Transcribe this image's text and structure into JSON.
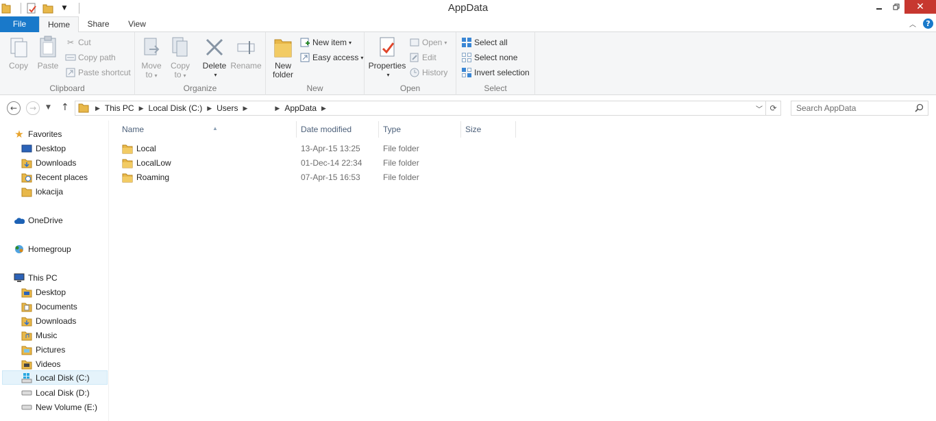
{
  "window": {
    "title": "AppData",
    "minimize_icon": "minimize-icon",
    "maximize_icon": "restore-icon",
    "close_glyph": "✕"
  },
  "quick_access": [
    "folder-icon",
    "properties-icon",
    "new-folder-icon",
    "dropdown-icon"
  ],
  "tabs": {
    "file": "File",
    "home": "Home",
    "share": "Share",
    "view": "View",
    "help_glyph": "?"
  },
  "ribbon": {
    "clipboard": {
      "label": "Clipboard",
      "copy": "Copy",
      "paste": "Paste",
      "cut": "Cut",
      "copy_path": "Copy path",
      "paste_shortcut": "Paste shortcut"
    },
    "organize": {
      "label": "Organize",
      "move_to_1": "Move",
      "move_to_2": "to",
      "copy_to_1": "Copy",
      "copy_to_2": "to",
      "delete": "Delete",
      "rename": "Rename"
    },
    "new": {
      "label": "New",
      "new_folder_1": "New",
      "new_folder_2": "folder",
      "new_item": "New item",
      "easy_access": "Easy access"
    },
    "open": {
      "label": "Open",
      "properties": "Properties",
      "open": "Open",
      "edit": "Edit",
      "history": "History"
    },
    "select": {
      "label": "Select",
      "select_all": "Select all",
      "select_none": "Select none",
      "invert_selection": "Invert selection"
    }
  },
  "address": {
    "crumbs": [
      "This PC",
      "Local Disk (C:)",
      "Users",
      "",
      "AppData"
    ],
    "search_placeholder": "Search AppData"
  },
  "nav": {
    "favorites": "Favorites",
    "favorites_items": [
      "Desktop",
      "Downloads",
      "Recent places",
      "lokacija"
    ],
    "onedrive": "OneDrive",
    "homegroup": "Homegroup",
    "this_pc": "This PC",
    "this_pc_items": [
      "Desktop",
      "Documents",
      "Downloads",
      "Music",
      "Pictures",
      "Videos",
      "Local Disk (C:)",
      "Local Disk (D:)",
      "New Volume (E:)"
    ]
  },
  "columns": {
    "name": "Name",
    "date_modified": "Date modified",
    "type": "Type",
    "size": "Size"
  },
  "files": [
    {
      "name": "Local",
      "date": "13-Apr-15 13:25",
      "type": "File folder"
    },
    {
      "name": "LocalLow",
      "date": "01-Dec-14 22:34",
      "type": "File folder"
    },
    {
      "name": "Roaming",
      "date": "07-Apr-15 16:53",
      "type": "File folder"
    }
  ],
  "colors": {
    "accent": "#1979ca",
    "close": "#c7372f",
    "folder": "#e8b84a"
  }
}
